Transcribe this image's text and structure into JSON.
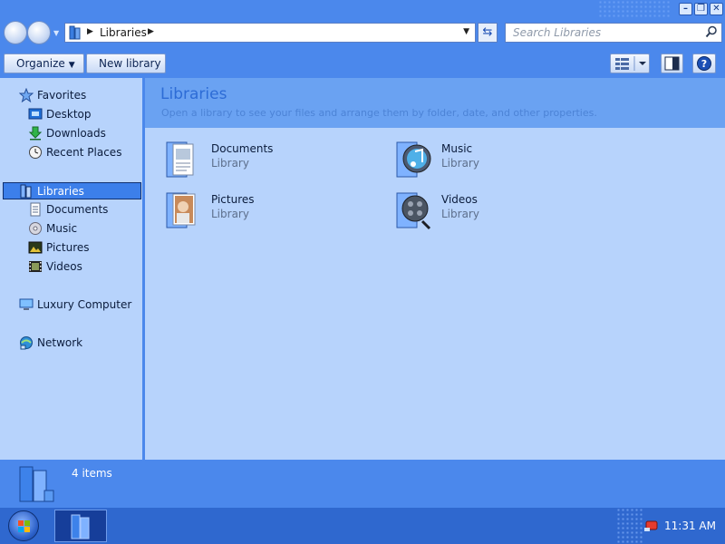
{
  "window": {
    "buttons": {
      "minimize": "–",
      "maximize": "❐",
      "close": "✕"
    }
  },
  "address": {
    "path": [
      "Libraries"
    ],
    "search_placeholder": "Search Libraries"
  },
  "toolbar": {
    "organize_label": "Organize",
    "new_library_label": "New library"
  },
  "sidebar": {
    "favorites": {
      "label": "Favorites",
      "items": [
        {
          "label": "Desktop",
          "icon": "desktop-icon"
        },
        {
          "label": "Downloads",
          "icon": "downloads-icon"
        },
        {
          "label": "Recent Places",
          "icon": "recent-places-icon"
        }
      ]
    },
    "libraries": {
      "label": "Libraries",
      "items": [
        {
          "label": "Documents",
          "icon": "documents-icon"
        },
        {
          "label": "Music",
          "icon": "music-icon"
        },
        {
          "label": "Pictures",
          "icon": "pictures-icon"
        },
        {
          "label": "Videos",
          "icon": "videos-icon"
        }
      ]
    },
    "computer": {
      "label": "Luxury Computer"
    },
    "network": {
      "label": "Network"
    }
  },
  "main": {
    "title": "Libraries",
    "subtitle": "Open a library to see your files and arrange them by folder, date, and other properties.",
    "libraries": [
      {
        "name": "Documents",
        "type": "Library",
        "icon": "documents-library-icon"
      },
      {
        "name": "Music",
        "type": "Library",
        "icon": "music-library-icon"
      },
      {
        "name": "Pictures",
        "type": "Library",
        "icon": "pictures-library-icon"
      },
      {
        "name": "Videos",
        "type": "Library",
        "icon": "videos-library-icon"
      }
    ]
  },
  "details": {
    "count": "4 items"
  },
  "taskbar": {
    "clock": "11:31 AM"
  },
  "colors": {
    "accent": "#4b88ec",
    "pane": "#b7d3fc",
    "header": "#6aa2f2"
  }
}
